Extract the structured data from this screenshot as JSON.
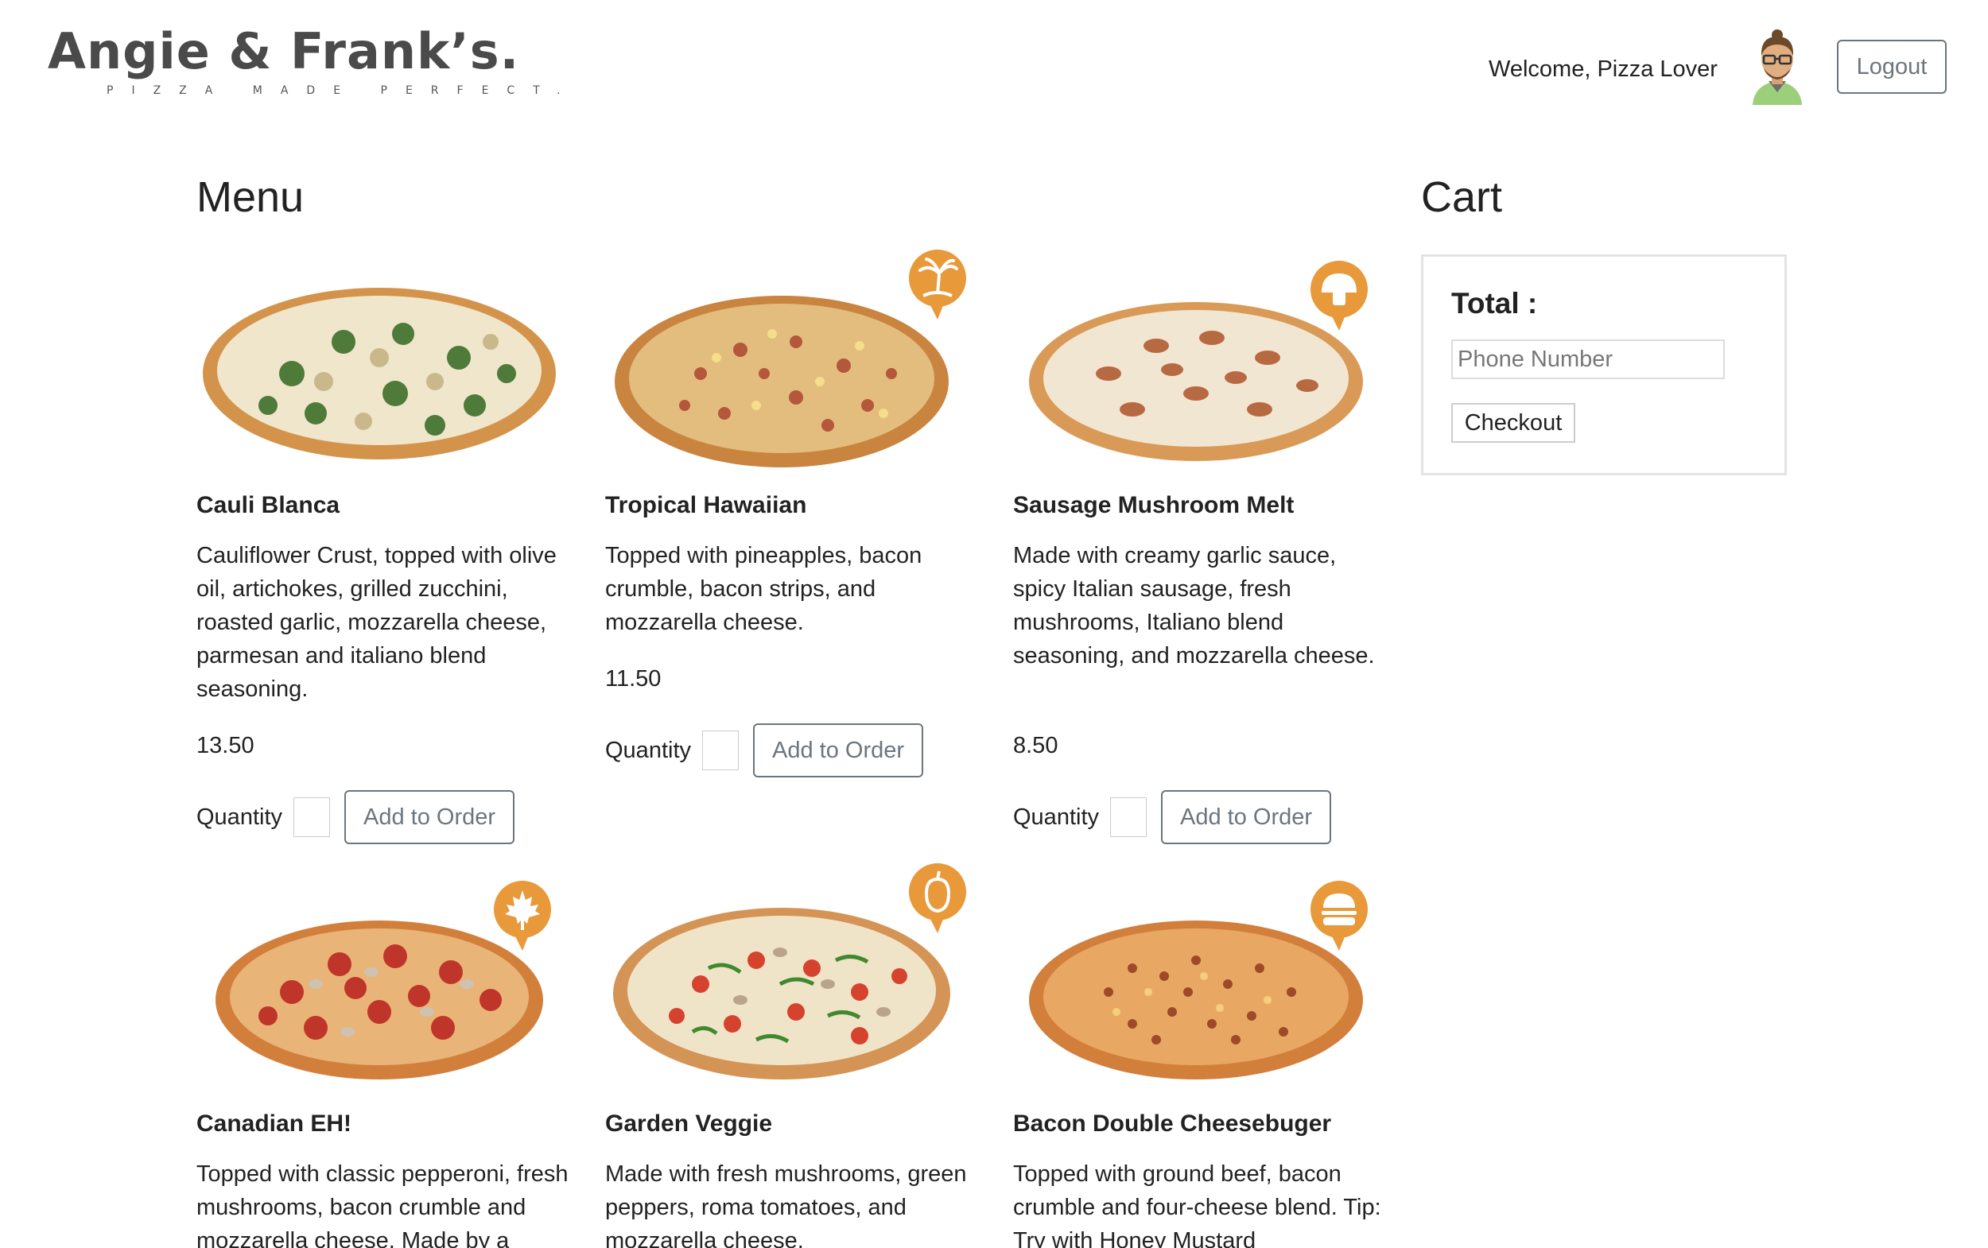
{
  "header": {
    "logo_title": "Angie & Frank’s.",
    "logo_tagline": "PIZZA MADE PERFECT.",
    "welcome_text": "Welcome, Pizza Lover",
    "logout_label": "Logout"
  },
  "menu": {
    "title": "Menu",
    "quantity_label": "Quantity",
    "add_label": "Add to Order",
    "items": [
      {
        "name": "Cauli Blanca",
        "description": "Cauliflower Crust, topped with olive oil, artichokes, grilled zucchini, roasted garlic, mozzarella cheese, parmesan and italiano blend seasoning.",
        "price": "13.50",
        "badge_icon": "none"
      },
      {
        "name": "Tropical Hawaiian",
        "description": "Topped with pineapples, bacon crumble, bacon strips, and mozzarella cheese.",
        "price": "11.50",
        "badge_icon": "palm-tree-icon"
      },
      {
        "name": "Sausage Mushroom Melt",
        "description": "Made with creamy garlic sauce, spicy Italian sausage, fresh mushrooms, Italiano blend seasoning, and mozzarella cheese.",
        "price": "8.50",
        "badge_icon": "mushroom-icon"
      },
      {
        "name": "Canadian EH!",
        "description": "Topped with classic pepperoni, fresh mushrooms, bacon crumble and mozzarella cheese. Made by a",
        "badge_icon": "maple-leaf-icon"
      },
      {
        "name": "Garden Veggie",
        "description": "Made with fresh mushrooms, green peppers, roma tomatoes, and mozzarella cheese.",
        "badge_icon": "pepper-icon"
      },
      {
        "name": "Bacon Double Cheesebuger",
        "description": "Topped with ground beef, bacon crumble and four-cheese blend. Tip: Try with Honey Mustard",
        "badge_icon": "burger-icon"
      }
    ]
  },
  "cart": {
    "title": "Cart",
    "total_label": "Total :",
    "phone_placeholder": "Phone Number",
    "checkout_label": "Checkout"
  },
  "colors": {
    "badge_orange": "#e8993a",
    "crust": "#d4934a",
    "text": "#222222",
    "button_border": "#6c757d"
  }
}
